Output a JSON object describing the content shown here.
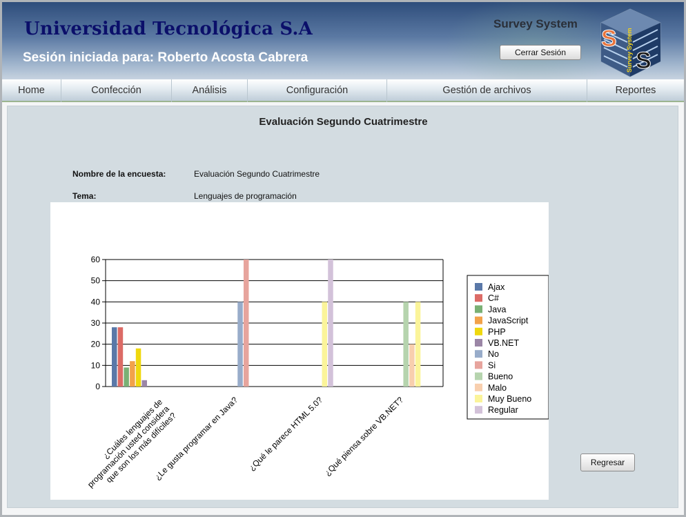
{
  "header": {
    "university_title": "Universidad Tecnológica S.A",
    "session_text": "Sesión iniciada para: Roberto Acosta Cabrera",
    "system_name": "Survey System",
    "logout_label": "Cerrar Sesión",
    "logo_text": "Survey System"
  },
  "nav": {
    "items": [
      {
        "label": "Home"
      },
      {
        "label": "Confección"
      },
      {
        "label": "Análisis"
      },
      {
        "label": "Configuración"
      },
      {
        "label": "Gestión de archivos"
      },
      {
        "label": "Reportes"
      }
    ]
  },
  "page": {
    "title": "Evaluación Segundo Cuatrimestre",
    "survey_name_label": "Nombre de la encuesta:",
    "survey_name_value": "Evaluación Segundo Cuatrimestre",
    "topic_label": "Tema:",
    "topic_value": "Lenguajes de programación",
    "back_label": "Regresar"
  },
  "chart_data": {
    "type": "bar",
    "title": "",
    "xlabel": "",
    "ylabel": "",
    "ylim": [
      0,
      60
    ],
    "yticks": [
      0,
      10,
      20,
      30,
      40,
      50,
      60
    ],
    "grid": true,
    "legend_position": "right",
    "categories": [
      [
        "¿Cuáles lenguajes de",
        "programación usted considera",
        "que son los más difíciles?"
      ],
      [
        "¿Le gusta programar en Java?"
      ],
      [
        "¿Qué le parece HTML 5.0?"
      ],
      [
        "¿Qué piensa sobre VB.NET?"
      ]
    ],
    "series": [
      {
        "name": "Ajax",
        "color": "#5a78a8",
        "values": [
          28,
          null,
          null,
          null
        ]
      },
      {
        "name": "C#",
        "color": "#dc6b66",
        "values": [
          28,
          null,
          null,
          null
        ]
      },
      {
        "name": "Java",
        "color": "#7ab074",
        "values": [
          9,
          null,
          null,
          null
        ]
      },
      {
        "name": "JavaScript",
        "color": "#f2a24a",
        "values": [
          12,
          null,
          null,
          null
        ]
      },
      {
        "name": "PHP",
        "color": "#efd80e",
        "values": [
          18,
          null,
          null,
          null
        ]
      },
      {
        "name": "VB.NET",
        "color": "#9b86a6",
        "values": [
          3,
          null,
          null,
          null
        ]
      },
      {
        "name": "No",
        "color": "#98acca",
        "values": [
          null,
          40,
          null,
          null
        ]
      },
      {
        "name": "Si",
        "color": "#e7a49d",
        "values": [
          null,
          60,
          null,
          null
        ]
      },
      {
        "name": "Bueno",
        "color": "#b6d4ae",
        "values": [
          null,
          null,
          null,
          40
        ]
      },
      {
        "name": "Malo",
        "color": "#f8cfae",
        "values": [
          null,
          null,
          null,
          20
        ]
      },
      {
        "name": "Muy Bueno",
        "color": "#fbf49a",
        "values": [
          null,
          null,
          40,
          40
        ]
      },
      {
        "name": "Regular",
        "color": "#d3c2d9",
        "values": [
          null,
          null,
          60,
          null
        ]
      }
    ]
  }
}
